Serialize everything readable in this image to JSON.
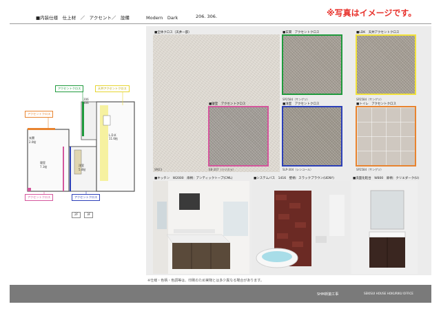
{
  "header": {
    "spec_title": "■内装仕様　仕上材　／　アクセント／　設備",
    "theme": "Modern　Dark",
    "units": "206. 306."
  },
  "notice": "※写真はイメージです。",
  "samples": {
    "wall": {
      "label": "■全体クロス（天井一部）",
      "code": "SM23"
    },
    "green": {
      "label": "■玄関　アクセントクロス",
      "code": "SP2584（サンゲツ）",
      "color": "#1e9a3c"
    },
    "yellow": {
      "label": "■LDK　天井アクセントクロス",
      "code": "SP2584（サンゲツ）",
      "color": "#f2e23a"
    },
    "pink": {
      "label": "■寝室　アクセントクロス",
      "code": "EB-207（リリカラ）",
      "color": "#d4559c"
    },
    "blue": {
      "label": "■洋室　アクセントクロス",
      "code": "SLP-304（シンコール）",
      "color": "#2b3fb8"
    },
    "orange": {
      "label": "■トイレ　アクセントクロス",
      "code": "SP2584（サンゲツ）",
      "color": "#e8832e"
    }
  },
  "equipment": {
    "kitchen": "■キッチン　W2000　扉柄：アンティックトープ(CML)",
    "bath": "■システムバス　1416　壁柄：スラックブラウン(UENY)",
    "vanity": "■洗面化粧台　W800　扉柄：クリエダーク(U)"
  },
  "plan": {
    "accent_green": "アクセントクロス",
    "accent_yellow": "天井アクセントクロス",
    "accent_orange": "アクセントクロス",
    "accent_pink": "アクセントクロス",
    "accent_blue": "アクセントクロス",
    "unit_tag": "206\n306",
    "room_ldk": "L.D.K\n11.6帖",
    "room_bed": "寝室\n7.1帖",
    "room_west": "洋室\n5.4帖",
    "room_entry": "玄関\n2.0帖",
    "floor2": "2F",
    "floor3": "3F"
  },
  "footnote": "※仕様・色柄・色調等は、印刷のため実物とは多少異なる場合があります。",
  "footer": {
    "center": "SHM新築工事",
    "right": "SEKISUI HOUSE  HOKURIKU OFFICE"
  }
}
